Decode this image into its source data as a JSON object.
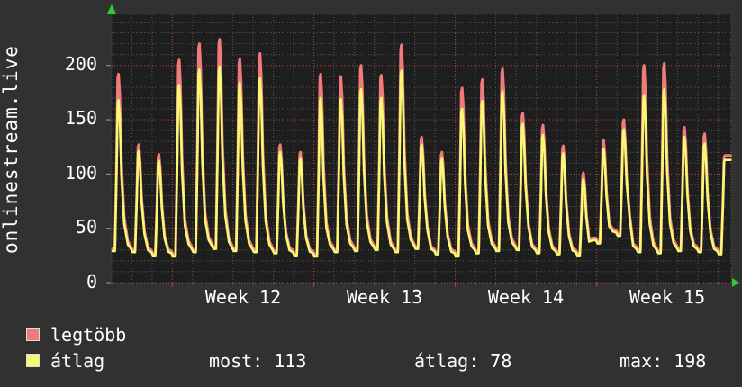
{
  "title": "onlinestream.live",
  "colors": {
    "page_bg": "#313131",
    "plot_bg": "#1e1e1e",
    "grid_minor": "#525252",
    "grid_major": "#b04848",
    "axis_tick": "#999999",
    "arrow_green": "#2ecc2e",
    "text": "#ffffff",
    "series_max": "#ef7b7b",
    "series_avg": "#f7f873"
  },
  "y_axis": {
    "ticks": [
      "200",
      "150",
      "100",
      "50",
      "0"
    ]
  },
  "x_axis": {
    "labels": [
      "Week 12",
      "Week 13",
      "Week 14",
      "Week 15"
    ]
  },
  "legend": {
    "series": [
      {
        "label": "legtöbb",
        "color": "#ef7b7b"
      },
      {
        "label": "átlag",
        "color": "#f7f873"
      }
    ],
    "stats": {
      "most": "most: 113",
      "avg": "átlag: 78",
      "max": "max: 198"
    }
  },
  "chart_data": {
    "type": "line",
    "title": "onlinestream.live",
    "xlabel": "",
    "ylabel": "",
    "ylim": [
      0,
      247
    ],
    "y_major_step": 50,
    "y_minor_step": 10,
    "days_total": 30.65,
    "week_line_days": [
      3,
      10,
      17,
      24
    ],
    "week_label_centers_days": [
      6.5,
      13.5,
      20.5,
      27.5
    ],
    "x_tick_labels": [
      "Week 12",
      "Week 13",
      "Week 14",
      "Week 15"
    ],
    "grid": true,
    "legend_position": "bottom-left",
    "stats": {
      "most": 113,
      "atlag": 78,
      "max": 198
    },
    "series": [
      {
        "name": "legtöbb",
        "color": "#ef7b7b",
        "daily_peaks": [
          192,
          127,
          118,
          205,
          220,
          224,
          206,
          211,
          127,
          120,
          192,
          190,
          200,
          191,
          219,
          134,
          120,
          179,
          187,
          197,
          156,
          145,
          126,
          101,
          131,
          150,
          200,
          202,
          143,
          137,
          117
        ],
        "daily_lows": [
          31,
          30,
          27,
          26,
          30,
          33,
          31,
          30,
          29,
          27,
          26,
          30,
          31,
          32,
          30,
          33,
          28,
          26,
          29,
          31,
          32,
          29,
          28,
          27,
          38,
          45,
          30,
          29,
          31,
          30,
          28
        ]
      },
      {
        "name": "átlag",
        "color": "#f7f873",
        "daily_peaks": [
          168,
          121,
          112,
          182,
          196,
          199,
          184,
          188,
          120,
          114,
          170,
          169,
          178,
          170,
          195,
          127,
          114,
          160,
          167,
          176,
          146,
          136,
          119,
          95,
          123,
          141,
          172,
          178,
          134,
          128,
          113
        ],
        "daily_lows": [
          29,
          28,
          25,
          24,
          28,
          31,
          29,
          28,
          27,
          25,
          24,
          28,
          29,
          30,
          28,
          31,
          26,
          24,
          27,
          29,
          30,
          27,
          26,
          25,
          36,
          43,
          28,
          27,
          29,
          28,
          26
        ]
      }
    ]
  }
}
